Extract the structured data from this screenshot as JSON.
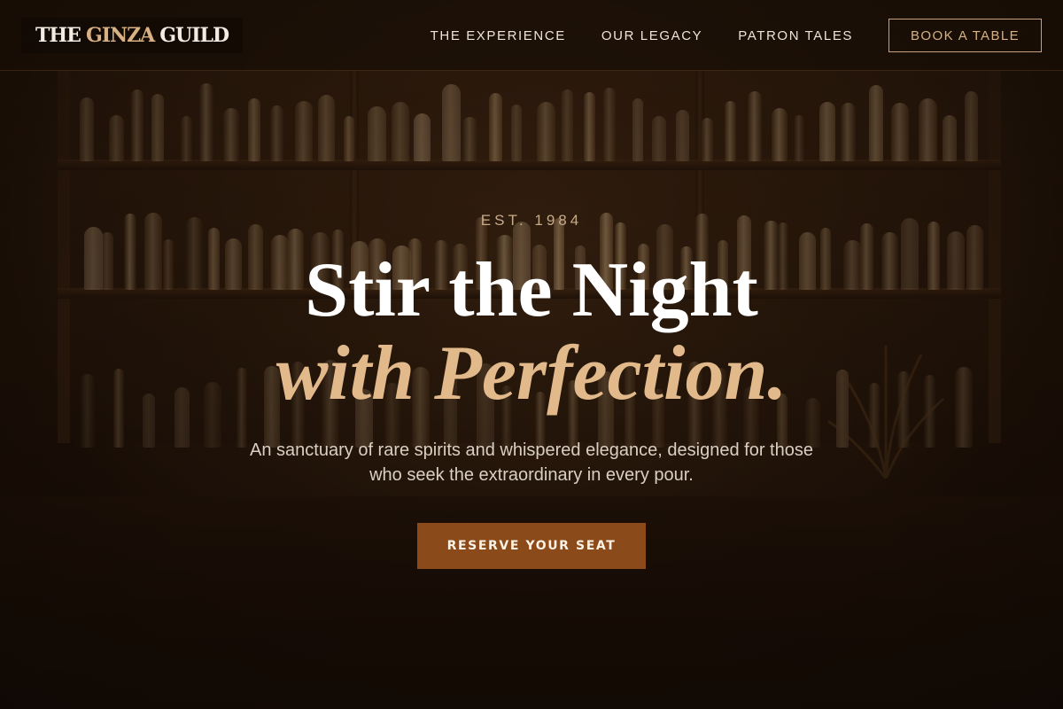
{
  "brand": {
    "part1": "THE",
    "accent": "GINZA",
    "part2": "GUILD"
  },
  "nav": {
    "links": [
      "THE EXPERIENCE",
      "OUR LEGACY",
      "PATRON TALES"
    ],
    "cta_label": "BOOK A TABLE"
  },
  "hero": {
    "eyebrow": "EST. 1984",
    "title_line1": "Stir the Night",
    "title_line2": "with Perfection.",
    "subtitle": "An sanctuary of rare spirits and whispered elegance, designed for those who seek the extraordinary in every pour.",
    "cta_label": "RESERVE YOUR SEAT"
  },
  "colors": {
    "background": "#1a0f07",
    "accent_gold": "#d8b184",
    "cta_brown": "#8b4a19"
  }
}
